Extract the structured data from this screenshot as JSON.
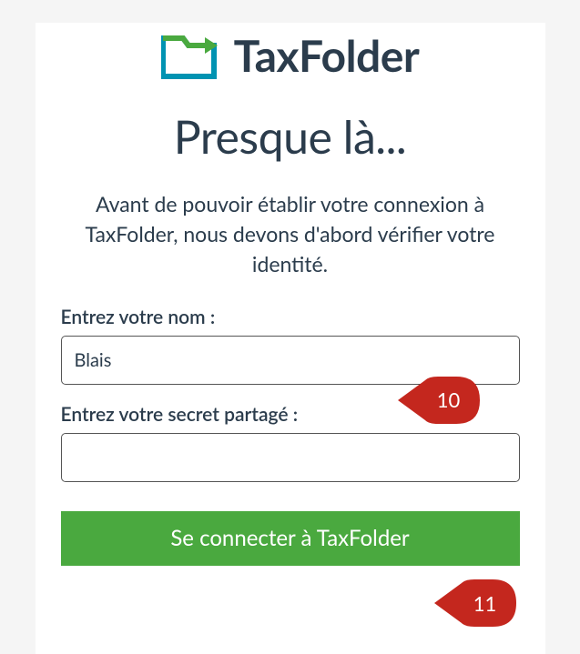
{
  "logo": {
    "text": "TaxFolder"
  },
  "heading": "Presque là...",
  "subheading": "Avant de pouvoir établir votre connexion à TaxFolder, nous devons d'abord vérifier votre identité.",
  "form": {
    "name_label": "Entrez votre nom :",
    "name_value": "Blais",
    "secret_label": "Entrez votre secret partagé :",
    "secret_value": "",
    "submit_label": "Se connecter à TaxFolder"
  },
  "callouts": {
    "step10": "10",
    "step11": "11"
  },
  "colors": {
    "primary_dark": "#2b3c4c",
    "accent_green": "#4aa93f",
    "callout_red": "#c4271e"
  }
}
